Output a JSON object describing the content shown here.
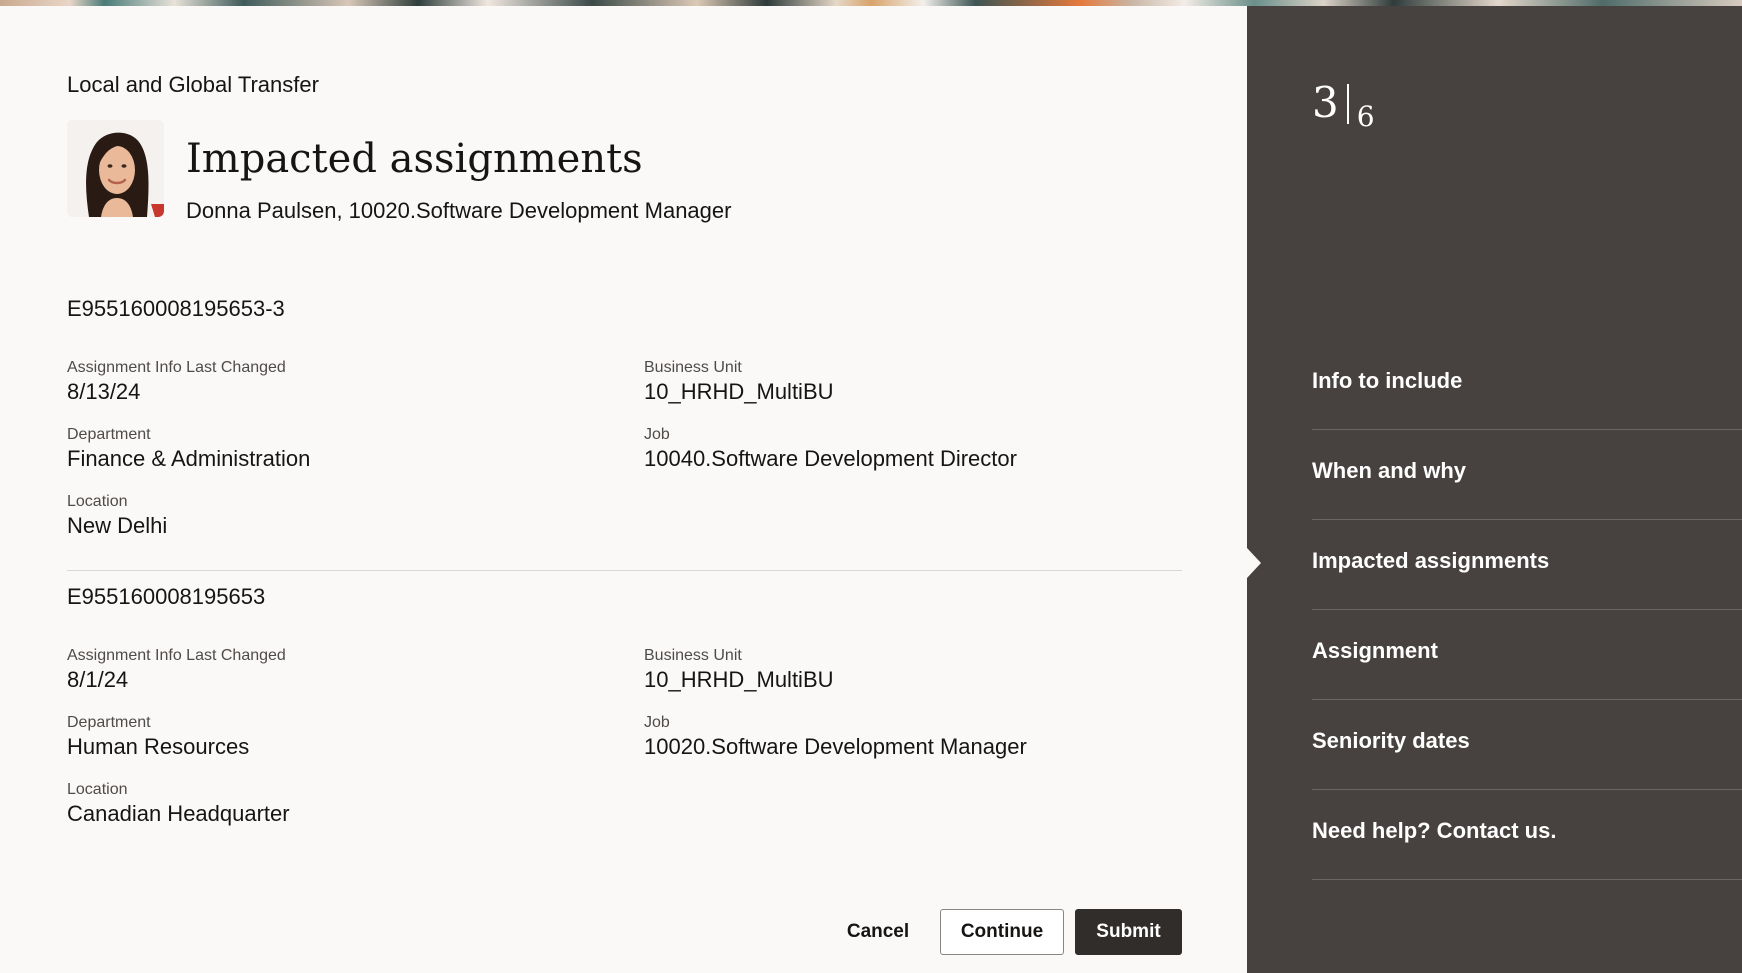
{
  "header": {
    "flow_title": "Local and Global Transfer",
    "page_title": "Impacted assignments",
    "person_subtitle": "Donna Paulsen, 10020.Software Development Manager"
  },
  "assignments": [
    {
      "id": "E955160008195653-3",
      "last_changed_label": "Assignment Info Last Changed",
      "last_changed_value": "8/13/24",
      "business_unit_label": "Business Unit",
      "business_unit_value": "10_HRHD_MultiBU",
      "department_label": "Department",
      "department_value": "Finance & Administration",
      "job_label": "Job",
      "job_value": "10040.Software Development Director",
      "location_label": "Location",
      "location_value": "New Delhi"
    },
    {
      "id": "E955160008195653",
      "last_changed_label": "Assignment Info Last Changed",
      "last_changed_value": "8/1/24",
      "business_unit_label": "Business Unit",
      "business_unit_value": "10_HRHD_MultiBU",
      "department_label": "Department",
      "department_value": "Human Resources",
      "job_label": "Job",
      "job_value": "10020.Software Development Manager",
      "location_label": "Location",
      "location_value": "Canadian Headquarter"
    }
  ],
  "actions": {
    "cancel_label": "Cancel",
    "continue_label": "Continue",
    "submit_label": "Submit"
  },
  "progress": {
    "current_step": "3",
    "total_steps": "6"
  },
  "steps": [
    {
      "label": "Info to include"
    },
    {
      "label": "When and why"
    },
    {
      "label": "Impacted assignments"
    },
    {
      "label": "Assignment"
    },
    {
      "label": "Seniority dates"
    },
    {
      "label": "Need help? Contact us."
    }
  ],
  "current_step_index": 2,
  "colors": {
    "sidebar_bg": "#47423f",
    "main_bg": "#fbf9f8",
    "primary_button": "#312d2a",
    "text": "#161513"
  }
}
